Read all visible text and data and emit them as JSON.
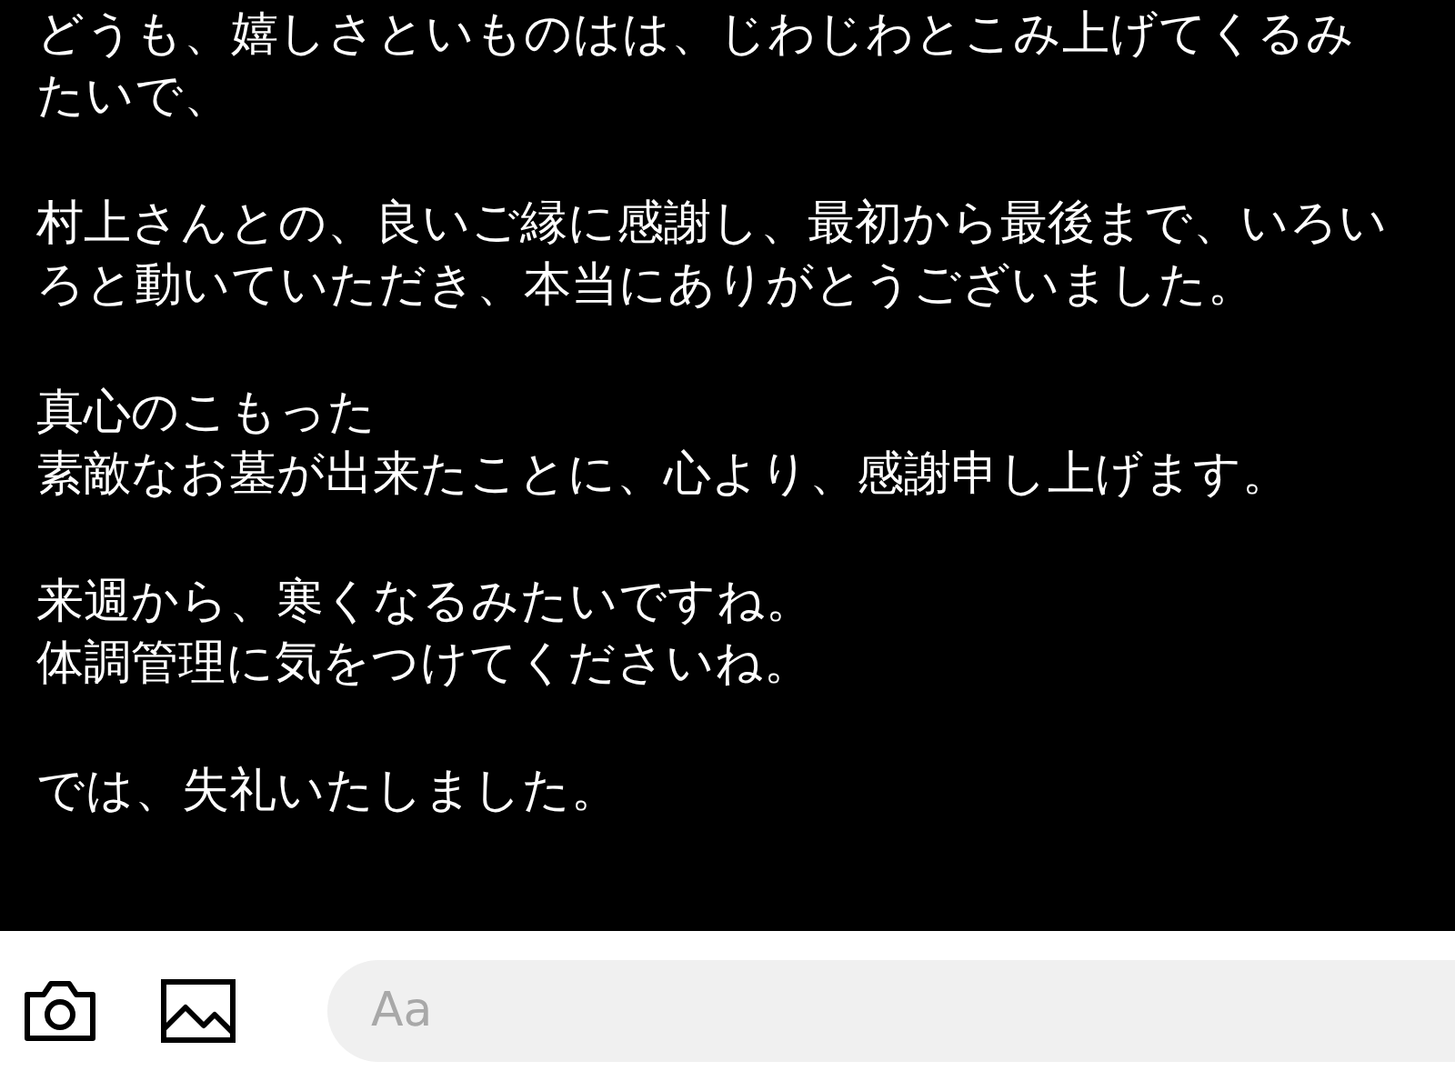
{
  "message": {
    "paragraphs": [
      {
        "lines": [
          "どうも、嬉しさといものはは、じわじわとこみ上げてくるみたいで、"
        ]
      },
      {
        "lines": [
          "村上さんとの、良いご縁に感謝し、最初から最後まで、いろいろと動いていただき、本当にありがとうございました。"
        ]
      },
      {
        "lines": [
          "真心のこもった",
          "素敵なお墓が出来たことに、心より、感謝申し上げます。"
        ]
      },
      {
        "lines": [
          "来週から、寒くなるみたいですね。",
          "体調管理に気をつけてくださいね。"
        ]
      },
      {
        "lines": [
          "では、失礼いたしました。"
        ]
      }
    ]
  },
  "composer": {
    "placeholder": "Aa"
  }
}
